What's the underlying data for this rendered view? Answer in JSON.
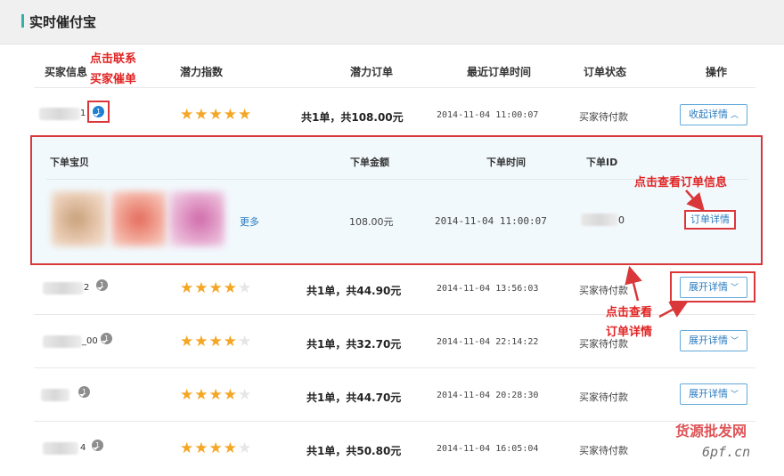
{
  "page": {
    "title": "实时催付宝"
  },
  "table": {
    "headers": [
      "买家信息",
      "潜力指数",
      "潜力订单",
      "最近订单时间",
      "订单状态",
      "操作"
    ]
  },
  "rows": [
    {
      "id_suffix": "1",
      "stars": 5,
      "summary": "共1单，共108.00元",
      "time": "2014-11-04 11:00:07",
      "status": "买家待付款",
      "action": "收起详情",
      "chat_count": "1"
    },
    {
      "id_suffix": "2",
      "stars": 4,
      "summary": "共1单，共44.90元",
      "time": "2014-11-04 13:56:03",
      "status": "买家待付款",
      "action": "展开详情",
      "chat_count": "1"
    },
    {
      "id_suffix": "_00",
      "stars": 4,
      "summary": "共1单，共32.70元",
      "time": "2014-11-04 22:14:22",
      "status": "买家待付款",
      "action": "展开详情",
      "chat_count": "1"
    },
    {
      "id_suffix": "",
      "stars": 4,
      "summary": "共1单，共44.70元",
      "time": "2014-11-04 20:28:30",
      "status": "买家待付款",
      "action": "展开详情",
      "chat_count": "1"
    },
    {
      "id_suffix": "4",
      "stars": 4,
      "summary": "共1单，共50.80元",
      "time": "2014-11-04 16:05:04",
      "status": "买家待付款",
      "action": "展开详情",
      "chat_count": "1"
    }
  ],
  "detail": {
    "headers": [
      "下单宝贝",
      "下单金额",
      "下单时间",
      "下单ID"
    ],
    "more": "更多",
    "amount": "108.00元",
    "time": "2014-11-04 11:00:07",
    "order_id_suffix": "0",
    "order_button": "订单详情"
  },
  "annotations": {
    "contact_line1": "点击联系",
    "contact_line2": "买家催单",
    "view_order_info": "点击查看订单信息",
    "view_order_line1": "点击查看",
    "view_order_line2": "订单详情"
  },
  "watermark": {
    "text": "货源批发网",
    "url": "6pf.cn"
  },
  "colors": {
    "accent": "#35b0a6",
    "star": "#f5a623",
    "link": "#2b7bbf",
    "annotation": "#d9373a"
  }
}
